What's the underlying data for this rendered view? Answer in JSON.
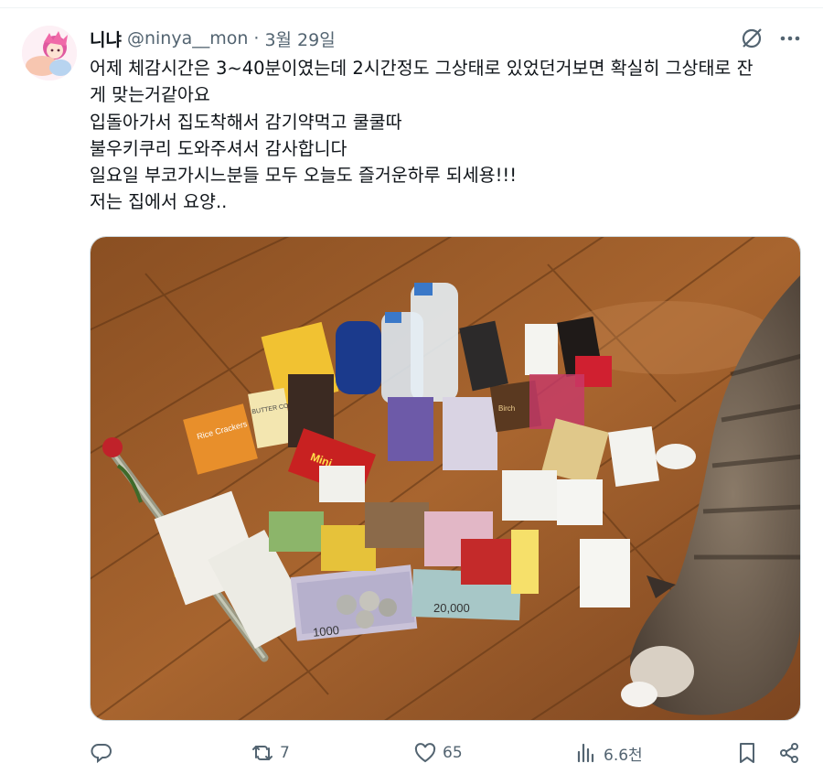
{
  "tweet": {
    "author_name": "니냐",
    "handle": "@ninya__mon",
    "separator": "·",
    "date": "3월 29일",
    "text_lines": [
      "어제 체감시간은 3~40분이였는데 2시간정도 그상태로 있었던거보면 확실히 그상태로 잔",
      "게 맞는거같아요",
      "입돌아가서 집도착해서 감기약먹고 쿨쿨따",
      "불우키쿠리 도와주셔서 감사합니다",
      "일요일 부코가시느분들 모두 오늘도 즐거운하루 되세용!!!",
      "저는 집에서 요양.."
    ],
    "media": {
      "wrapper_texts": [
        "Rice Crackers",
        "BUTTER COOKIE",
        "Mini",
        "Birch",
        "1000",
        "20,000"
      ]
    }
  },
  "actions": {
    "reply": {
      "icon": "reply-icon",
      "count": ""
    },
    "retweet": {
      "icon": "retweet-icon",
      "count": "7"
    },
    "like": {
      "icon": "heart-icon",
      "count": "65"
    },
    "views": {
      "icon": "views-icon",
      "count": "6.6천"
    },
    "bookmark": {
      "icon": "bookmark-icon"
    },
    "share": {
      "icon": "share-icon"
    }
  },
  "colors": {
    "text": "#0f1419",
    "secondary": "#536471",
    "floor": "#a0622e"
  }
}
